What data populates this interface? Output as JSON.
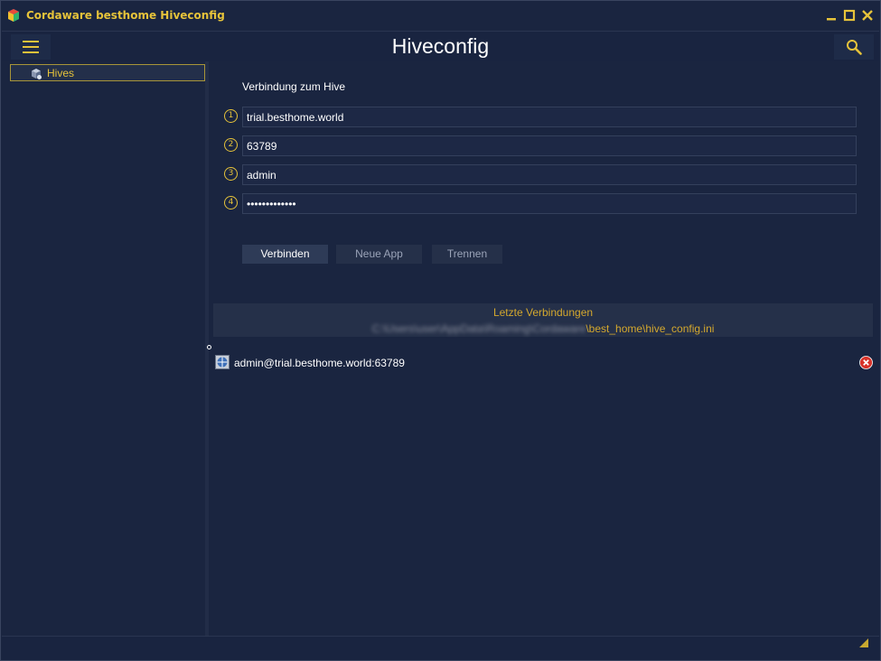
{
  "window": {
    "title": "Cordaware besthome Hiveconfig",
    "icons": [
      "app-logo-icon",
      "minimize-icon",
      "maximize-icon",
      "close-icon"
    ]
  },
  "header": {
    "title": "Hiveconfig",
    "menu_icon": "hamburger-menu-icon",
    "search_icon": "search-icon"
  },
  "sidebar": {
    "items": [
      {
        "label": "Hives",
        "icon": "hives-icon",
        "selected": true
      }
    ]
  },
  "connection": {
    "section_label": "Verbindung zum Hive",
    "fields": [
      {
        "number": "1",
        "value": "trial.besthome.world",
        "type": "text"
      },
      {
        "number": "2",
        "value": "63789",
        "type": "text"
      },
      {
        "number": "3",
        "value": "admin",
        "type": "text"
      },
      {
        "number": "4",
        "value": "•••••••••••••",
        "type": "password"
      }
    ],
    "buttons": {
      "connect": "Verbinden",
      "new_app": "Neue App",
      "disconnect": "Trennen"
    }
  },
  "recent": {
    "title": "Letzte Verbindungen",
    "path_blurred": "C:\\Users\\user\\AppData\\Roaming\\Cordaware",
    "path_suffix": "\\best_home\\hive_config.ini",
    "items": [
      {
        "label": "admin@trial.besthome.world:63789",
        "icon": "hive-connection-icon",
        "delete_icon": "delete-icon"
      }
    ]
  },
  "colors": {
    "background": "#1a2540",
    "accent": "#e6c33a",
    "text": "#ffffff",
    "button": "#2e3b57"
  }
}
